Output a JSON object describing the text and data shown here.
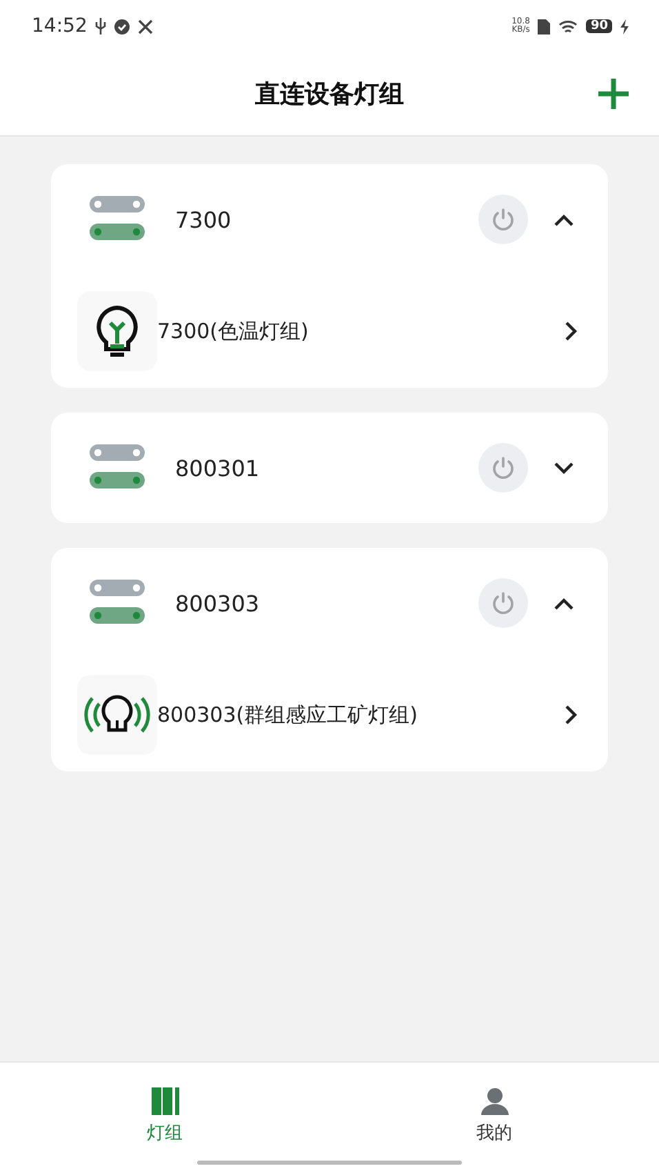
{
  "status_bar": {
    "time": "14:52",
    "net_speed_value": "10.8",
    "net_speed_unit": "KB/s",
    "battery": "90"
  },
  "header": {
    "title": "直连设备灯组"
  },
  "groups": [
    {
      "name": "7300",
      "expanded": true,
      "items": [
        {
          "label": "7300(色温灯组)",
          "kind": "color-temp"
        }
      ]
    },
    {
      "name": "800301",
      "expanded": false
    },
    {
      "name": "800303",
      "expanded": true,
      "items": [
        {
          "label": "800303(群组感应工矿灯组)",
          "kind": "sensor"
        }
      ]
    }
  ],
  "tabs": [
    {
      "label": "灯组",
      "kind": "groups",
      "selected": true
    },
    {
      "label": "我的",
      "kind": "profile",
      "selected": false
    }
  ]
}
